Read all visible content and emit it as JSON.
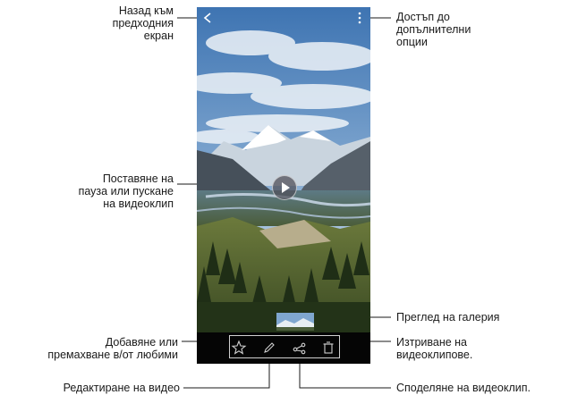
{
  "callouts": {
    "back": [
      "Назад към",
      "предходния",
      "екран"
    ],
    "more_options": [
      "Достъп до",
      "допълнителни",
      "опции"
    ],
    "play_pause": [
      "Поставяне на",
      "пауза или пускане",
      "на видеоклип"
    ],
    "gallery_preview": [
      "Преглед на галерия"
    ],
    "favorites": [
      "Добавяне или",
      "премахване в/от любими"
    ],
    "delete": [
      "Изтриване на",
      "видеоклипове."
    ],
    "edit": [
      "Редактиране на видео"
    ],
    "share": [
      "Споделяне на видеоклип."
    ]
  },
  "icons": {
    "back": "back-arrow-icon",
    "more": "more-options-icon",
    "play": "play-icon",
    "favorite": "star-icon",
    "edit": "pencil-icon",
    "share": "share-icon",
    "delete": "trash-icon"
  },
  "colors": {
    "callout_line": "#1a1a1a",
    "dot": "#1a1a1a",
    "bottombar": "#050505",
    "icon": "#cfcfcf"
  }
}
